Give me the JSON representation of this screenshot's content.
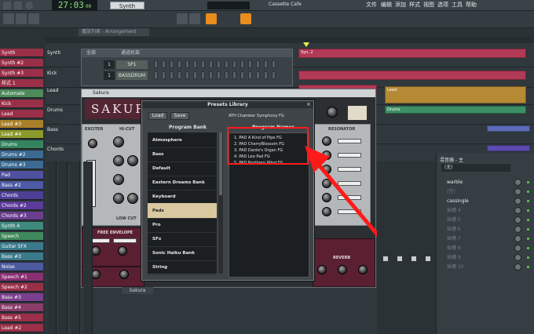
{
  "topbar": {
    "time": "27:03",
    "time_small": "00",
    "pattern": "Synth",
    "tempo": "",
    "song_title": "Cassette Cafe",
    "menu": [
      "文件",
      "编辑",
      "添加",
      "样式",
      "视图",
      "选项",
      "工具",
      "帮助"
    ]
  },
  "toolbar2": {
    "arrangement": "播放列表 - Arrangement"
  },
  "channel_rack_title": "通道机架",
  "channel_rack_filter": "全部",
  "channels": [
    {
      "num": "1",
      "name": "SP1"
    },
    {
      "num": "1",
      "name": "BASSDRUM"
    }
  ],
  "tracks": [
    {
      "label": "Synth",
      "color": "#9a2f48"
    },
    {
      "label": "Synth #2",
      "color": "#9a2f48"
    },
    {
      "label": "Synth #3",
      "color": "#9a2f48"
    },
    {
      "label": "样式 1",
      "color": "#9a2f48"
    },
    {
      "label": "Automate",
      "color": "#4e8a5c"
    },
    {
      "label": "Kick",
      "color": "#9a2f48"
    },
    {
      "label": "Lead",
      "color": "#9a2f48"
    },
    {
      "label": "Lead #3",
      "color": "#a8802a"
    },
    {
      "label": "Lead #4",
      "color": "#8b9a2c"
    },
    {
      "label": "Drums",
      "color": "#34845f"
    },
    {
      "label": "Drums #2",
      "color": "#3b6a92"
    },
    {
      "label": "Drums #3",
      "color": "#3b6a92"
    },
    {
      "label": "Pad",
      "color": "#50519e"
    },
    {
      "label": "Bass #2",
      "color": "#4d5aa5"
    },
    {
      "label": "Chords",
      "color": "#4e3f96"
    },
    {
      "label": "Chords #2",
      "color": "#5c3b9a"
    },
    {
      "label": "Chords #3",
      "color": "#6a3d8e"
    },
    {
      "label": "Synth 4",
      "color": "#3f8a7e"
    },
    {
      "label": "Speech",
      "color": "#3f8a5d"
    },
    {
      "label": "Guitar SFX",
      "color": "#3b7a8a"
    },
    {
      "label": "Bass #3",
      "color": "#3b7a8a"
    },
    {
      "label": "Noise",
      "color": "#4c5aa0"
    },
    {
      "label": "Speech #1",
      "color": "#8a2f72"
    },
    {
      "label": "Speech #2",
      "color": "#9a2f48"
    },
    {
      "label": "Bass #3",
      "color": "#7a3f8e"
    },
    {
      "label": "Bass #4",
      "color": "#8a3d6a"
    },
    {
      "label": "Bass #5",
      "color": "#9a2f48"
    },
    {
      "label": "Lead #2",
      "color": "#9a2f48"
    }
  ],
  "playlist_tracks": [
    {
      "label": "Synth",
      "color": "#9a2f48"
    },
    {
      "label": "Kick",
      "color": "#9a2f48"
    },
    {
      "label": "Lead",
      "color": "#9a2f48"
    },
    {
      "label": "Drums",
      "color": "#34845f"
    },
    {
      "label": "Bass",
      "color": "#3b6a92"
    },
    {
      "label": "Chords",
      "color": "#4e3f96"
    }
  ],
  "plugin": {
    "title": "Sakura",
    "name": "SAKURA",
    "sections": [
      "EXCITER",
      "HI-CUT",
      "FREE ENVELOPE",
      "LOW CUT",
      "RESONATOR",
      "REVERB"
    ],
    "bottom_name": "Sakura"
  },
  "presets": {
    "title": "Presets Library",
    "load": "Load",
    "save": "Save",
    "current": "ATH Chamber Symphony FG",
    "bank_header": "Program Bank",
    "names_header": "Program Names",
    "banks": [
      "Atmosphere",
      "Bass",
      "Default",
      "Eastern Dreams Bank",
      "Keyboard",
      "Pads",
      "Pro",
      "SFx",
      "Sonic Haiku Bank",
      "String"
    ],
    "selected_bank": "Pads",
    "names": [
      "1. PAD A Kind of Pipe FG",
      "2. PAD CherryBlossom FG",
      "3. PAD Dante's Organ FG",
      "4. PAD Leo Pad FG",
      "5. PAD Northern Wind FG"
    ]
  },
  "mixer": {
    "title": "混音器 - 主",
    "preset": "(无)",
    "slots": [
      "warble",
      "(空)",
      "cassingle",
      "插槽 4",
      "插槽 5",
      "插槽 6",
      "插槽 7",
      "插槽 8",
      "插槽 9",
      "插槽 10"
    ]
  },
  "annotation_color": "#ff1a1a"
}
